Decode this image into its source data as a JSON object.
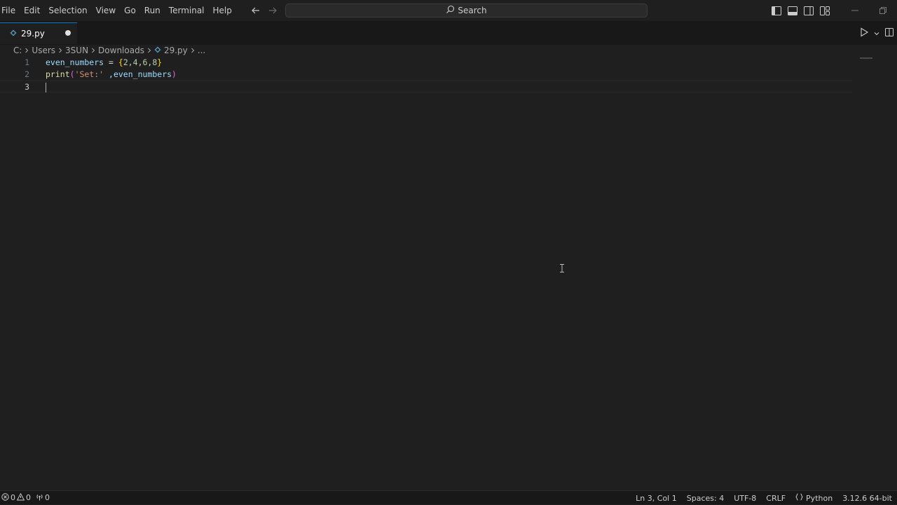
{
  "menu": [
    "File",
    "Edit",
    "Selection",
    "View",
    "Go",
    "Run",
    "Terminal",
    "Help"
  ],
  "search": {
    "label": "Search"
  },
  "tab": {
    "filename": "29.py",
    "modified": true
  },
  "breadcrumb": {
    "items": [
      "C:",
      "Users",
      "3SUN",
      "Downloads"
    ],
    "file": "29.py",
    "more": "..."
  },
  "editor": {
    "line_numbers": [
      "1",
      "2",
      "3"
    ],
    "current_line": 3,
    "code": {
      "line1": {
        "var": "even_numbers",
        "op": " = ",
        "open": "{",
        "nums": "2,4,6,8",
        "close": "}"
      },
      "line2": {
        "fn": "print",
        "open": "(",
        "str": "'Set:'",
        "rest": " ,even_numbers",
        "close": ")"
      },
      "line3": ""
    }
  },
  "status": {
    "errors": "0",
    "warnings": "0",
    "ports": "0",
    "position": "Ln 3, Col 1",
    "spaces": "Spaces: 4",
    "encoding": "UTF-8",
    "eol": "CRLF",
    "language": "Python",
    "interpreter": "3.12.6 64-bit"
  },
  "colors": {
    "background": "#1f1f1f",
    "tab_accent": "#0078d4",
    "variable": "#9cdcfe",
    "function": "#dcdcaa",
    "string": "#ce9178",
    "number": "#b5cea8",
    "brace": "#ffd700",
    "paren": "#da70d6",
    "python_icon": "#519aba"
  }
}
